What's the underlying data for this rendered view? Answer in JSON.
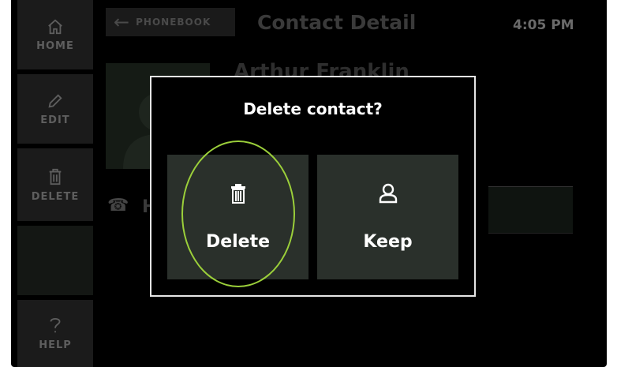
{
  "sidebar": {
    "home_label": "HOME",
    "edit_label": "EDIT",
    "delete_label": "DELETE",
    "help_label": "HELP"
  },
  "header": {
    "back_label": "PHONEBOOK",
    "title": "Contact Detail",
    "time": "4:05 PM"
  },
  "contact": {
    "name": "Arthur Franklin",
    "phone_label_initial": "H"
  },
  "dialog": {
    "title": "Delete contact?",
    "delete_label": "Delete",
    "keep_label": "Keep"
  },
  "colors": {
    "highlight": "#9bcf3a",
    "option_bg": "#2a302b",
    "modal_border": "#e6e6e6"
  }
}
